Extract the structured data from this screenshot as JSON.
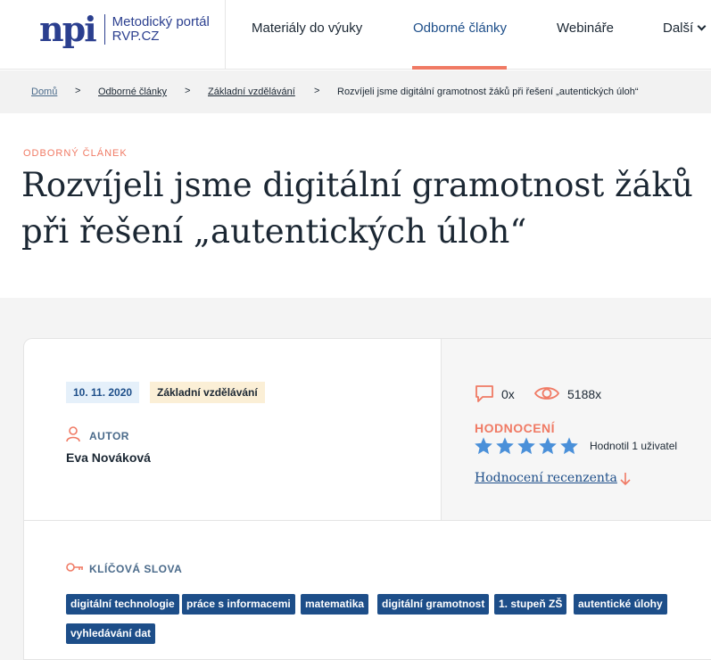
{
  "header": {
    "logo_mark": "npi",
    "logo_line1": "Metodický portál",
    "logo_line2": "RVP.CZ",
    "nav": [
      {
        "label": "Materiály do výuky"
      },
      {
        "label": "Odborné články"
      },
      {
        "label": "Webináře"
      },
      {
        "label": "Další"
      }
    ]
  },
  "breadcrumb": {
    "items": [
      "Domů",
      "Odborné články",
      "Základní vzdělávání",
      "Rozvíjeli jsme digitální gramotnost žáků při řešení „autentických úloh“"
    ],
    "separator": ">"
  },
  "article": {
    "kicker": "ODBORNÝ ČLÁNEK",
    "title": "Rozvíjeli jsme digitální gramotnost žáků při řešení „autentických úloh“"
  },
  "meta": {
    "date": "10. 11. 2020",
    "level": "Základní vzdělávání",
    "author_label": "AUTOR",
    "author_name": "Eva Nováková",
    "comments": "0x",
    "views": "5188x",
    "rating_label": "HODNOCENÍ",
    "rating_stars": 5,
    "rating_count": "Hodnotil 1 uživatel",
    "review_link": "Hodnocení recenzenta"
  },
  "keywords": {
    "label": "KLÍČOVÁ SLOVA",
    "tags": [
      "digitální technologie",
      "práce s informacemi",
      "matematika",
      "digitální gramotnost",
      "1. stupeň ZŠ",
      "autentické úlohy",
      "vyhledávání dat"
    ]
  },
  "colors": {
    "brand": "#2b3f8f",
    "accent": "#f07a64",
    "tag_bg": "#1d4e89",
    "star": "#4a90d9"
  }
}
